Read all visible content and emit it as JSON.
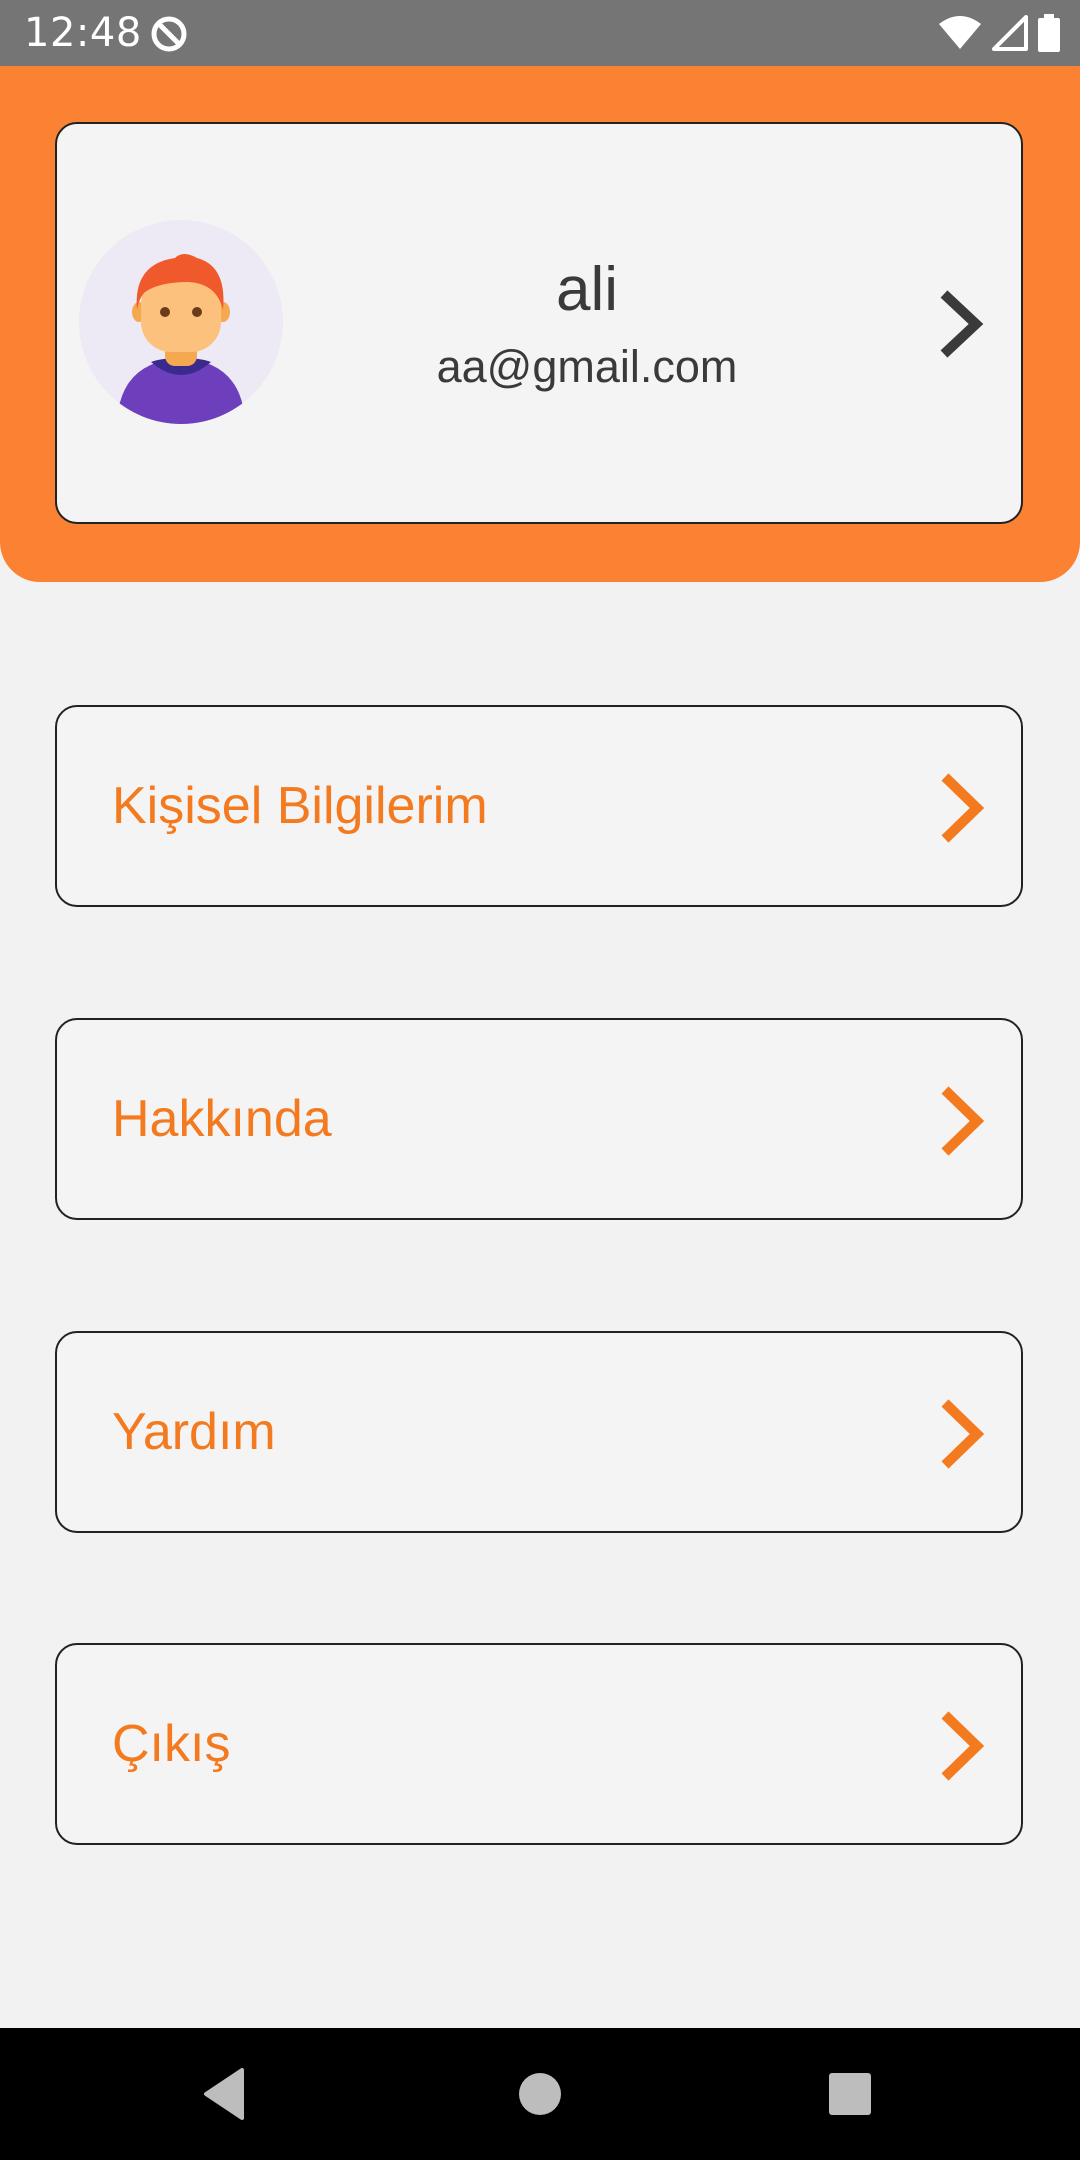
{
  "status_bar": {
    "time": "12:48",
    "app_icon": "data-saver-icon",
    "icons": [
      "wifi-icon",
      "signal-icon",
      "battery-icon"
    ]
  },
  "profile": {
    "name": "ali",
    "email": "aa@gmail.com",
    "avatar_icon": "user-avatar-icon",
    "chevron_icon": "chevron-right-icon"
  },
  "menu": {
    "items": [
      {
        "label": "Kişisel Bilgilerim",
        "icon": "chevron-right-icon"
      },
      {
        "label": "Hakkında",
        "icon": "chevron-right-icon"
      },
      {
        "label": "Yardım",
        "icon": "chevron-right-icon"
      },
      {
        "label": "Çıkış",
        "icon": "chevron-right-icon"
      }
    ]
  },
  "nav_bar": {
    "buttons": [
      "back-icon",
      "home-icon",
      "recents-icon"
    ]
  },
  "colors": {
    "accent": "#fb8232",
    "menu_text": "#f47a20",
    "card_background": "#f4f4f4",
    "page_background": "#f2f2f2",
    "status_bar": "#757575"
  }
}
